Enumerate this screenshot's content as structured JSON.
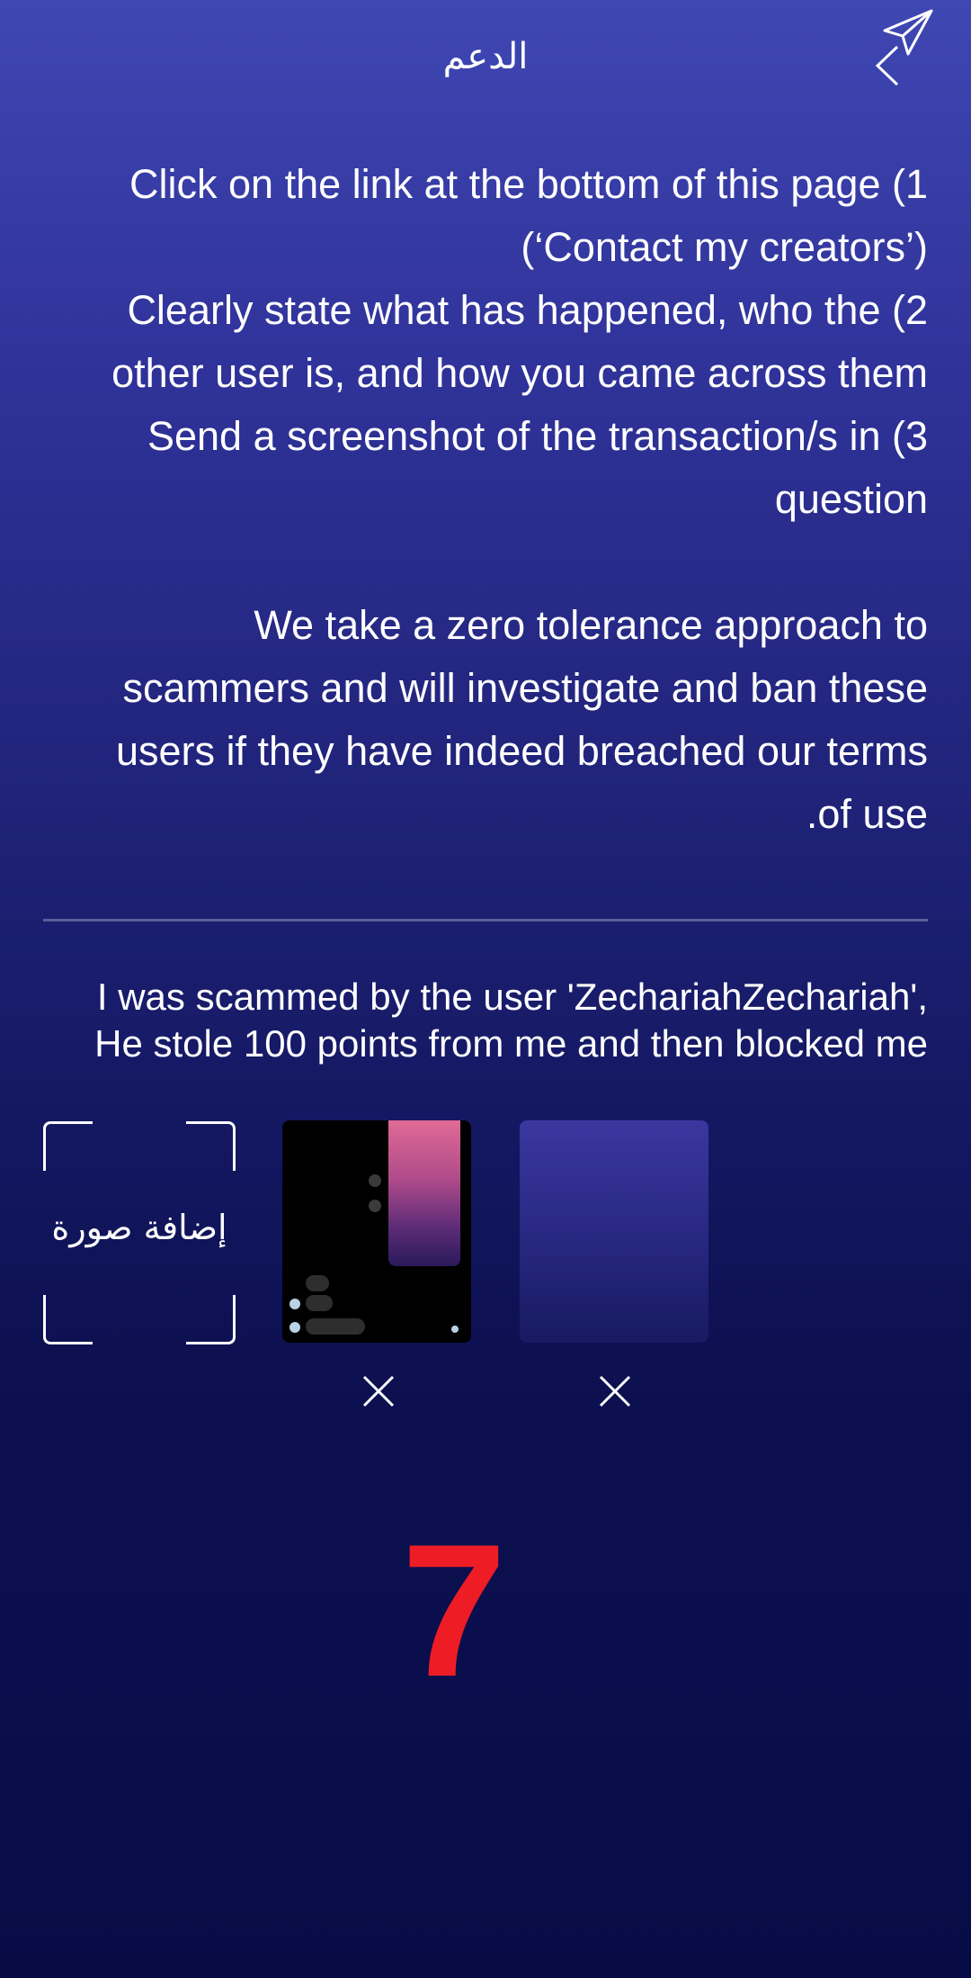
{
  "header": {
    "title": "الدعم",
    "back_icon": "chevron-left-icon",
    "send_icon": "paper-plane-icon"
  },
  "instructions": {
    "lines": [
      "Click on the link at the bottom of this page (1",
      "(‘Contact my creators’)",
      "Clearly state what has happened, who the (2",
      "other user is, and how you came across them",
      "Send a screenshot of the transaction/s in (3",
      "question"
    ],
    "policy_lines": [
      "We take a zero tolerance approach to",
      "scammers and will investigate and ban these",
      "users if they have indeed breached our terms",
      ".of use"
    ]
  },
  "message": {
    "line1": "I was scammed by the user 'ZechariahZechariah',",
    "line2": "He stole 100 points from me and then blocked me"
  },
  "attachments": {
    "add_photo_label": "إضافة صورة",
    "remove_icon": "close-icon"
  },
  "overlay_number": "7",
  "colors": {
    "accent_red": "#ee1c25",
    "background_top": "#3f47b3",
    "background_bottom": "#070b46"
  }
}
